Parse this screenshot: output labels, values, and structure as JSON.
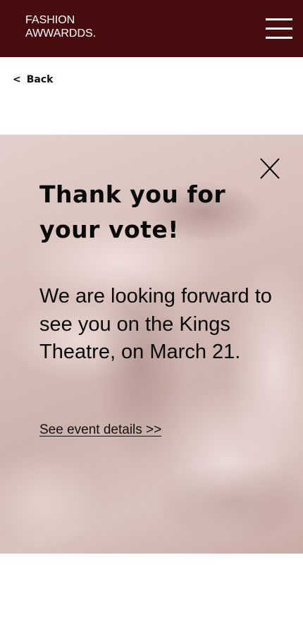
{
  "header": {
    "logo_line1": "FASHION",
    "logo_line2": "AWWARDDS.",
    "menu_icon": "hamburger-menu-icon",
    "background_color": "#470c0e"
  },
  "nav": {
    "back_chevron": "<",
    "back_label": "Back"
  },
  "modal": {
    "close_icon": "close-x-icon",
    "title": "Thank you for your vote!",
    "message": "We are looking forward to see you on the Kings Theatre, on March 21.",
    "link_label": "See event details >>"
  }
}
